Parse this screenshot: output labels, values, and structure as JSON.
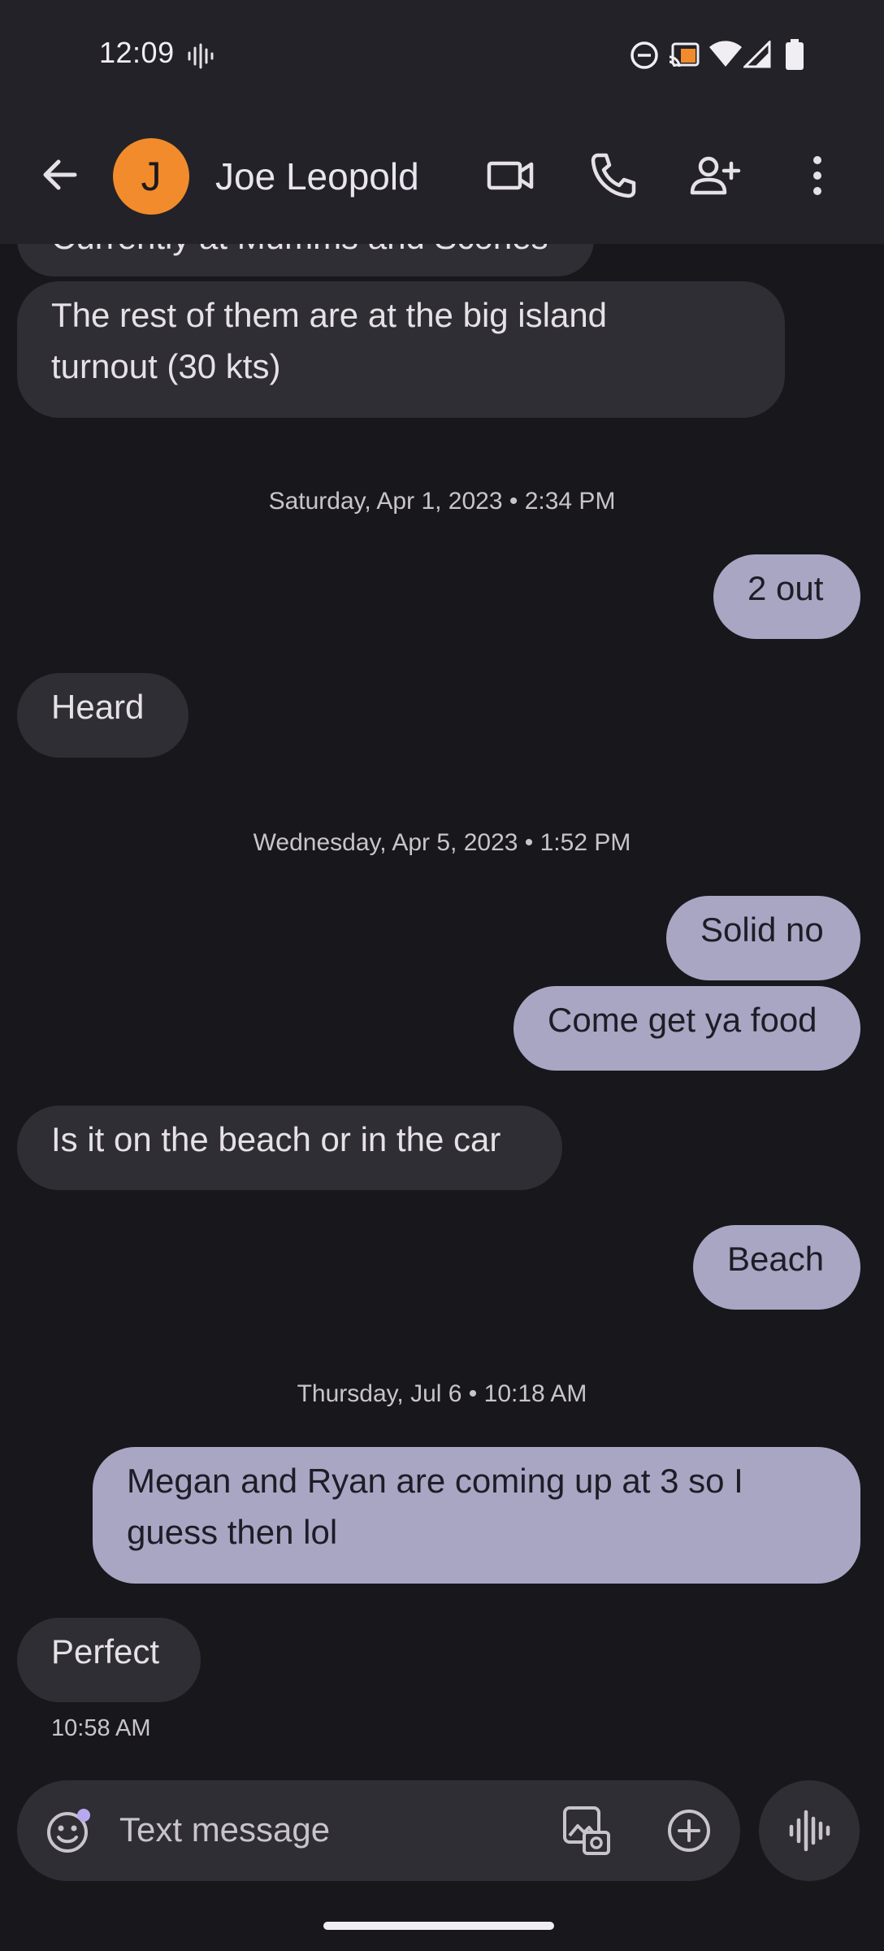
{
  "status_bar": {
    "time": "12:09",
    "icons": [
      "voice-wave-icon",
      "do-not-disturb-icon",
      "cast-icon",
      "wifi-icon",
      "signal-icon",
      "battery-icon"
    ]
  },
  "header": {
    "avatar_letter": "J",
    "contact_name": "Joe Leopold",
    "actions": [
      "back-arrow-icon",
      "video-call-icon",
      "phone-icon",
      "add-person-icon",
      "more-vert-icon"
    ]
  },
  "conversation": {
    "cut_message": "Currently at Mumms and Scones",
    "messages_1": {
      "m1": "The rest of them are at the big island",
      "m1b": "turnout (30 kts)"
    },
    "date_1": "Saturday, Apr 1, 2023 • 2:34 PM",
    "m2": "2 out",
    "m3": "Heard",
    "date_2": "Wednesday, Apr 5, 2023 • 1:52 PM",
    "m4": "Solid no",
    "m5": "Come get ya food",
    "m6": "Is it on the beach or in the car",
    "m7": "Beach",
    "date_3": "Thursday, Jul 6 • 10:18 AM",
    "m8a": "Megan and Ryan are coming up at 3 so I",
    "m8b": "guess then lol",
    "m9": "Perfect",
    "last_time": "10:58 AM"
  },
  "composer": {
    "placeholder": "Text message",
    "icons": [
      "emoji-icon",
      "gallery-icon",
      "add-circle-icon",
      "voice-message-icon"
    ]
  },
  "colors": {
    "background": "#18171c",
    "header": "#232228",
    "incoming_bubble": "#2f2e34",
    "outgoing_bubble": "#a9a6c4",
    "avatar": "#f28b2b"
  }
}
